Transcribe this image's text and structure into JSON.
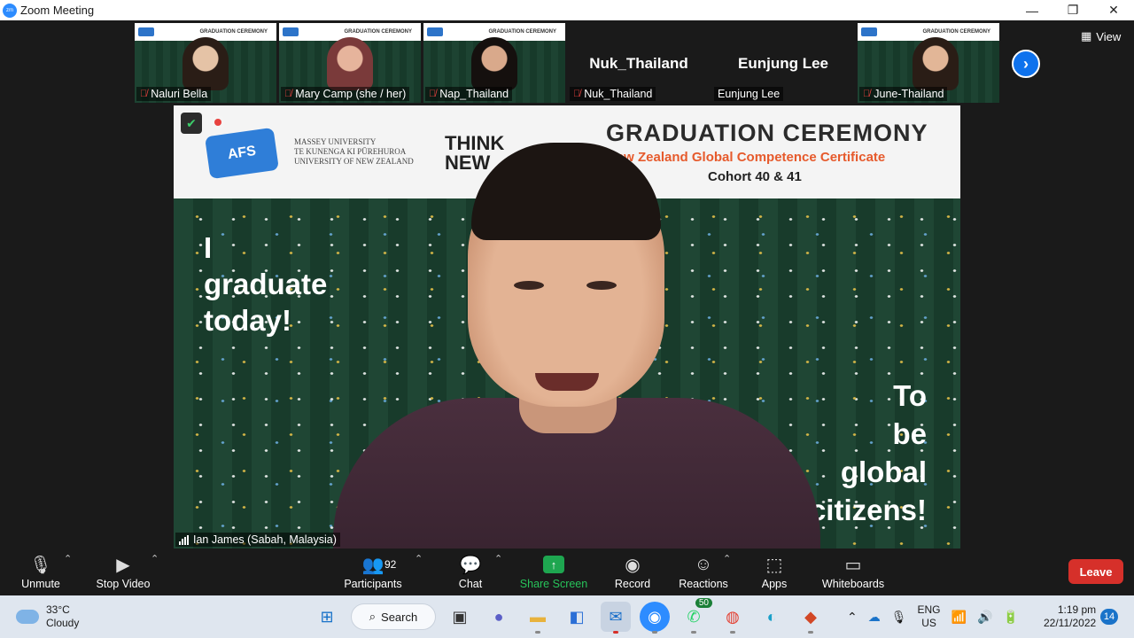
{
  "window": {
    "title": "Zoom Meeting",
    "minimize": "—",
    "maximize": "❐",
    "close": "✕"
  },
  "gallery": {
    "view_label": "View",
    "tiles": [
      {
        "name": "Naluri Bella",
        "muted": true,
        "video": true
      },
      {
        "name": "Mary Camp (she / her)",
        "muted": true,
        "video": true
      },
      {
        "name": "Nap_Thailand",
        "muted": true,
        "video": true
      },
      {
        "name": "Nuk_Thailand",
        "display_name": "Nuk_Thailand",
        "muted": true,
        "video": false
      },
      {
        "name": "Eunjung Lee",
        "display_name": "Eunjung Lee",
        "muted": false,
        "video": false
      },
      {
        "name": "June-Thailand",
        "muted": true,
        "video": true
      }
    ]
  },
  "speaker": {
    "name": "Ian James (Sabah, Malaysia)",
    "slide": {
      "logo_afs": "AFS",
      "massey_line1": "MASSEY UNIVERSITY",
      "massey_line2": "TE KUNENGA KI PŪREHUROA",
      "massey_line3": "UNIVERSITY OF NEW ZEALAND",
      "think_line1": "THINK",
      "think_line2": "NEW",
      "title": "GRADUATION CEREMONY",
      "subtitle": "New Zealand Global Competence Certificate",
      "cohort": "Cohort 40 & 41",
      "left_line1": "I",
      "left_line2": "graduate",
      "left_line3": "today!",
      "right_line1": "To",
      "right_line2": "be",
      "right_line3": "global",
      "right_line4": "citizens!"
    }
  },
  "toolbar": {
    "unmute": "Unmute",
    "stop_video": "Stop Video",
    "participants": "Participants",
    "participants_count": "92",
    "chat": "Chat",
    "share_screen": "Share Screen",
    "record": "Record",
    "reactions": "Reactions",
    "apps": "Apps",
    "whiteboards": "Whiteboards",
    "leave": "Leave"
  },
  "taskbar": {
    "temperature": "33°C",
    "weather": "Cloudy",
    "search": "Search",
    "whatsapp_badge": "50",
    "lang_line1": "ENG",
    "lang_line2": "US",
    "time": "1:19 pm",
    "date": "22/11/2022",
    "notifications": "14"
  },
  "colors": {
    "zoom_blue": "#0e72ed",
    "leave_red": "#d6302a",
    "share_green": "#1ea650",
    "muted_red": "#e8423f"
  }
}
